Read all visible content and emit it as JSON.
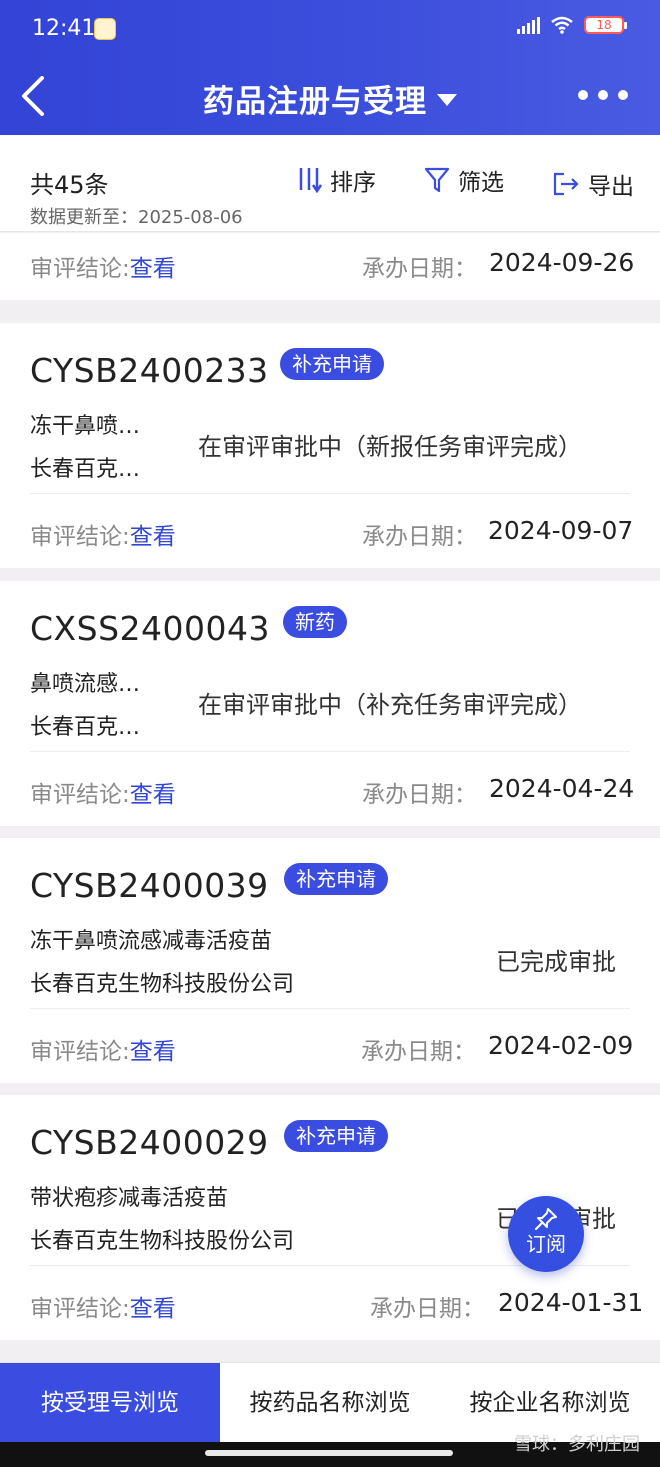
{
  "status_bar": {
    "time": "12:41",
    "network": "5G",
    "battery": "18"
  },
  "header": {
    "title": "药品注册与受理"
  },
  "toolbar": {
    "count": "共45条",
    "updated": "数据更新至：2025-08-06",
    "sort_label": "排序",
    "filter_label": "筛选",
    "export_label": "导出"
  },
  "partial_card": {
    "conclusion_label": "审评结论:",
    "conclusion_link": "查看",
    "date_label": "承办日期：",
    "date": "2024-09-26"
  },
  "cards": [
    {
      "code": "CYSB2400233",
      "tag": "补充申请",
      "line1": "冻干鼻喷…",
      "line2": "长春百克…",
      "status": "在审评审批中（新报任务审评完成）",
      "conclusion_label": "审评结论:",
      "conclusion_link": "查看",
      "date_label": "承办日期：",
      "date": "2024-09-07"
    },
    {
      "code": "CXSS2400043",
      "tag": "新药",
      "line1": "鼻喷流感…",
      "line2": "长春百克…",
      "status": "在审评审批中（补充任务审评完成）",
      "conclusion_label": "审评结论:",
      "conclusion_link": "查看",
      "date_label": "承办日期：",
      "date": "2024-04-24"
    },
    {
      "code": "CYSB2400039",
      "tag": "补充申请",
      "line1": "冻干鼻喷流感减毒活疫苗",
      "line2": "长春百克生物科技股份公司",
      "status": "已完成审批",
      "conclusion_label": "审评结论:",
      "conclusion_link": "查看",
      "date_label": "承办日期：",
      "date": "2024-02-09"
    },
    {
      "code": "CYSB2400029",
      "tag": "补充申请",
      "line1": "带状疱疹减毒活疫苗",
      "line2": "长春百克生物科技股份公司",
      "status": "已完成审批",
      "conclusion_label": "审评结论:",
      "conclusion_link": "查看",
      "date_label": "承办日期：",
      "date": "2024-01-31"
    }
  ],
  "fab": {
    "label": "订阅"
  },
  "tabs": [
    {
      "label": "按受理号浏览",
      "active": true
    },
    {
      "label": "按药品名称浏览",
      "active": false
    },
    {
      "label": "按企业名称浏览",
      "active": false
    }
  ],
  "watermark": "雪球：多利庄园",
  "colors": {
    "primary": "#3a4de0",
    "link": "#2f46d6",
    "muted": "#8a8a8a",
    "page_bg": "#f1eff2"
  }
}
